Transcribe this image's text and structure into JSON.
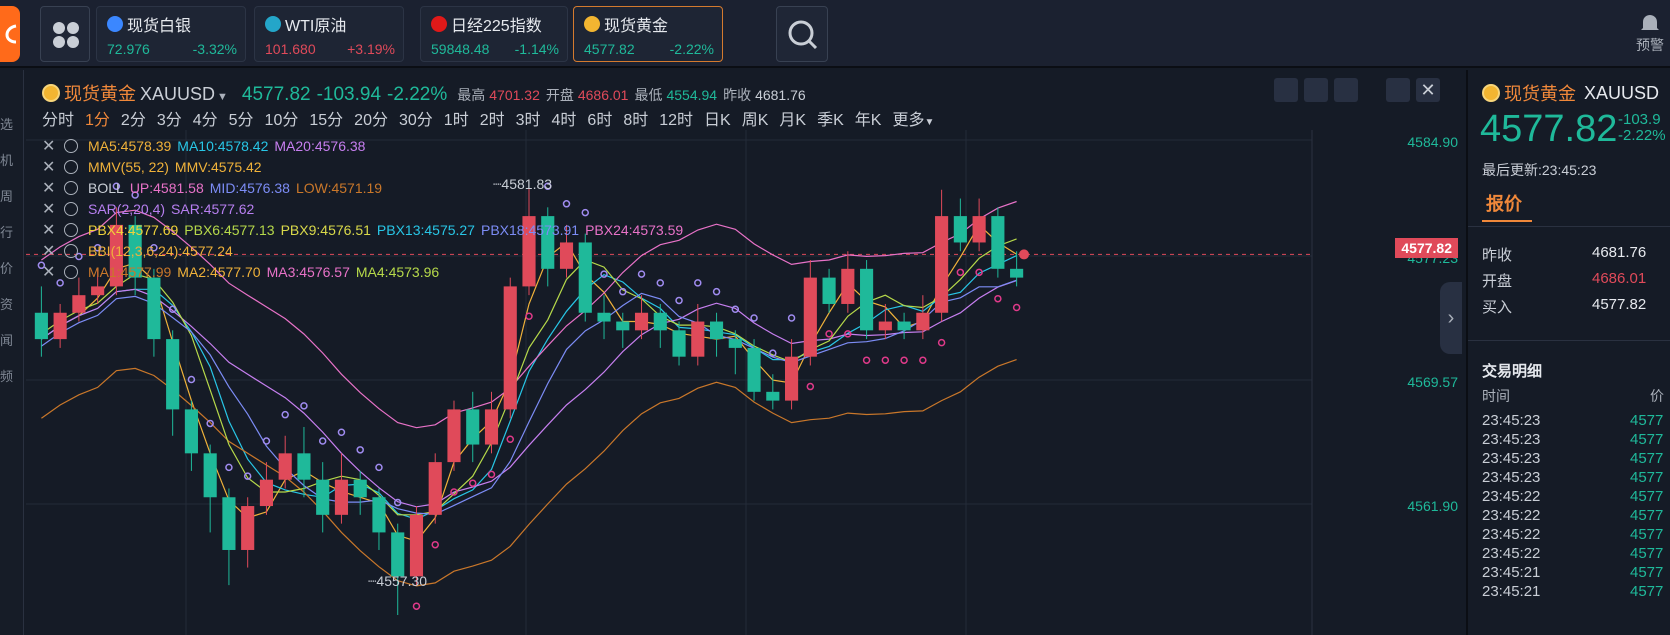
{
  "cards": [
    {
      "name": "现货白银",
      "price": "72.976",
      "change": "-3.32%",
      "pcolor": "#1fb99a",
      "ccolor": "#1fb99a",
      "icon": "#3b87ff"
    },
    {
      "name": "WTI原油",
      "price": "101.680",
      "change": "+3.19%",
      "pcolor": "#e04a5a",
      "ccolor": "#e04a5a",
      "icon": "#24a6c9"
    },
    {
      "name": "日经225指数",
      "price": "59848.48",
      "change": "-1.14%",
      "pcolor": "#1fb99a",
      "ccolor": "#1fb99a",
      "icon": "#e01919"
    },
    {
      "name": "现货黄金",
      "price": "4577.82",
      "change": "-2.22%",
      "pcolor": "#1fb99a",
      "ccolor": "#1fb99a",
      "icon": "#f2b531"
    }
  ],
  "alert_label": "预警",
  "left_labels": [
    "选",
    "机",
    "周",
    "行",
    "价",
    "资",
    "闻",
    "频"
  ],
  "header": {
    "name": "现货黄金",
    "symbol": "XAUUSD",
    "price": "4577.82",
    "change": "-103.94",
    "pct": "-2.22%",
    "high_label": "最高",
    "high": "4701.32",
    "open_label": "开盘",
    "open": "4686.01",
    "low_label": "最低",
    "low": "4554.94",
    "prev_label": "昨收",
    "prev": "4681.76"
  },
  "periods": [
    "分时",
    "1分",
    "2分",
    "3分",
    "4分",
    "5分",
    "10分",
    "15分",
    "20分",
    "30分",
    "1时",
    "2时",
    "3时",
    "4时",
    "6时",
    "8时",
    "12时",
    "日K",
    "周K",
    "月K",
    "季K",
    "年K",
    "更多"
  ],
  "active_period": "1分",
  "indicators": [
    [
      [
        "MA5:4578.39",
        "#f0b23a"
      ],
      [
        "MA10:4578.42",
        "#28c6e6"
      ],
      [
        "MA20:4576.38",
        "#c77ff0"
      ]
    ],
    [
      [
        "MMV(55, 22)",
        "#f0b23a"
      ],
      [
        "MMV:4575.42",
        "#f0b23a"
      ]
    ],
    [
      [
        "BOLL",
        "#c9ced6"
      ],
      [
        "UP:4581.58",
        "#e872c8"
      ],
      [
        "MID:4576.38",
        "#7c8cf5"
      ],
      [
        "LOW:4571.19",
        "#c9772a"
      ]
    ],
    [
      [
        "SAR(2,20,4)",
        "#b77ff0"
      ],
      [
        "SAR:4577.62",
        "#b77ff0"
      ]
    ],
    [
      [
        "PBX4:4577.69",
        "#f0d23a"
      ],
      [
        "PBX6:4577.13",
        "#b6d94a"
      ],
      [
        "PBX9:4576.51",
        "#d9d94a"
      ],
      [
        "PBX13:4575.27",
        "#28c6e6"
      ],
      [
        "PBX18:4573.91",
        "#7c8cf5"
      ],
      [
        "PBX24:4573.59",
        "#e872c8"
      ]
    ],
    [
      [
        "BBI(12,3,6,24):4577.24",
        "#f0b23a"
      ]
    ],
    [
      [
        "MA1:4577.99",
        "#c9772a"
      ],
      [
        "MA2:4577.70",
        "#f0b23a"
      ],
      [
        "MA3:4576.57",
        "#e872c8"
      ],
      [
        "MA4:4573.96",
        "#b6d94a"
      ]
    ]
  ],
  "chart_data": {
    "type": "candlestick",
    "y_ticks": [
      "4584.90",
      "4577.23",
      "4569.57",
      "4561.90"
    ],
    "y_range": [
      4557.3,
      4584.9
    ],
    "current_price": "4577.82",
    "max_label": "4581.83",
    "min_label": "4557.30",
    "candles": [
      [
        4574.5,
        4573,
        4576,
        4572
      ],
      [
        4573,
        4574.5,
        4575,
        4572.5
      ],
      [
        4574.5,
        4575.5,
        4576.5,
        4574
      ],
      [
        4575.5,
        4576,
        4577,
        4575
      ],
      [
        4576,
        4579.5,
        4580.5,
        4575.5
      ],
      [
        4579.5,
        4576.5,
        4580,
        4575.5
      ],
      [
        4576.5,
        4573,
        4577,
        4572
      ],
      [
        4573,
        4569,
        4573.5,
        4567.5
      ],
      [
        4569,
        4566.5,
        4569.5,
        4565.5
      ],
      [
        4566.5,
        4564,
        4567,
        4562
      ],
      [
        4564,
        4561,
        4564.5,
        4559
      ],
      [
        4561,
        4563.5,
        4564,
        4560
      ],
      [
        4563.5,
        4565,
        4566,
        4563
      ],
      [
        4565,
        4566.5,
        4567.5,
        4564.5
      ],
      [
        4566.5,
        4565,
        4568,
        4564
      ],
      [
        4565,
        4563,
        4566,
        4562
      ],
      [
        4563,
        4565,
        4566.5,
        4562.5
      ],
      [
        4565,
        4564,
        4565.5,
        4563
      ],
      [
        4564,
        4562,
        4564.5,
        4561
      ],
      [
        4562,
        4559.5,
        4562.5,
        4557.3
      ],
      [
        4559.5,
        4563,
        4563.5,
        4559
      ],
      [
        4563,
        4566,
        4566.5,
        4562.5
      ],
      [
        4566,
        4569,
        4569.5,
        4565.5
      ],
      [
        4569,
        4567,
        4570,
        4566
      ],
      [
        4567,
        4569,
        4570,
        4566.5
      ],
      [
        4569,
        4576,
        4576.5,
        4568.5
      ],
      [
        4576,
        4580,
        4581.83,
        4575.5
      ],
      [
        4580,
        4577,
        4580.5,
        4576
      ],
      [
        4577,
        4578.5,
        4579.5,
        4576.5
      ],
      [
        4578.5,
        4574.5,
        4579,
        4574
      ],
      [
        4574.5,
        4574,
        4575.5,
        4573
      ],
      [
        4574,
        4573.5,
        4574.5,
        4572.5
      ],
      [
        4573.5,
        4574.5,
        4575.5,
        4573
      ],
      [
        4574.5,
        4573.5,
        4575,
        4572.5
      ],
      [
        4573.5,
        4572,
        4574,
        4571.5
      ],
      [
        4572,
        4574,
        4575,
        4571.5
      ],
      [
        4574,
        4573,
        4574.5,
        4572
      ],
      [
        4573,
        4572.5,
        4573.5,
        4571
      ],
      [
        4572.5,
        4570,
        4573,
        4569.5
      ],
      [
        4570,
        4569.5,
        4571,
        4569
      ],
      [
        4569.5,
        4572,
        4573,
        4569
      ],
      [
        4572,
        4576.5,
        4577.5,
        4571.5
      ],
      [
        4576.5,
        4575,
        4577,
        4574.5
      ],
      [
        4575,
        4577,
        4578,
        4574.5
      ],
      [
        4577,
        4573.5,
        4577.5,
        4573
      ],
      [
        4573.5,
        4574,
        4575,
        4573
      ],
      [
        4574,
        4573.5,
        4574.5,
        4573
      ],
      [
        4573.5,
        4574.5,
        4575.5,
        4573
      ],
      [
        4574.5,
        4580,
        4581.5,
        4574
      ],
      [
        4580,
        4578.5,
        4581,
        4578
      ],
      [
        4578.5,
        4580,
        4581,
        4578
      ],
      [
        4580,
        4577,
        4580.5,
        4576.5
      ],
      [
        4577,
        4576.5,
        4578,
        4576
      ]
    ],
    "series": [
      {
        "name": "MA5",
        "color": "#f0b23a"
      },
      {
        "name": "MA10",
        "color": "#28c6e6"
      },
      {
        "name": "MA20",
        "color": "#c77ff0"
      },
      {
        "name": "UP",
        "color": "#e872c8"
      },
      {
        "name": "LOW",
        "color": "#c9772a"
      }
    ]
  },
  "right_panel": {
    "name": "现货黄金",
    "symbol": "XAUUSD",
    "price": "4577.82",
    "change": "-103.9",
    "pct": "-2.22%",
    "update_label": "最后更新:23:45:23",
    "tab": "报价",
    "rows": [
      [
        "昨收",
        "4681.76",
        "#e6e9ee"
      ],
      [
        "开盘",
        "4686.01",
        "#e04a5a"
      ],
      [
        "买入",
        "4577.82",
        "#e6e9ee"
      ]
    ],
    "trades_title": "交易明细",
    "time_col": "时间",
    "price_col": "价",
    "trades": [
      [
        "23:45:23",
        "4577"
      ],
      [
        "23:45:23",
        "4577"
      ],
      [
        "23:45:23",
        "4577"
      ],
      [
        "23:45:23",
        "4577"
      ],
      [
        "23:45:22",
        "4577"
      ],
      [
        "23:45:22",
        "4577"
      ],
      [
        "23:45:22",
        "4577"
      ],
      [
        "23:45:22",
        "4577"
      ],
      [
        "23:45:21",
        "4577"
      ],
      [
        "23:45:21",
        "4577"
      ]
    ]
  }
}
